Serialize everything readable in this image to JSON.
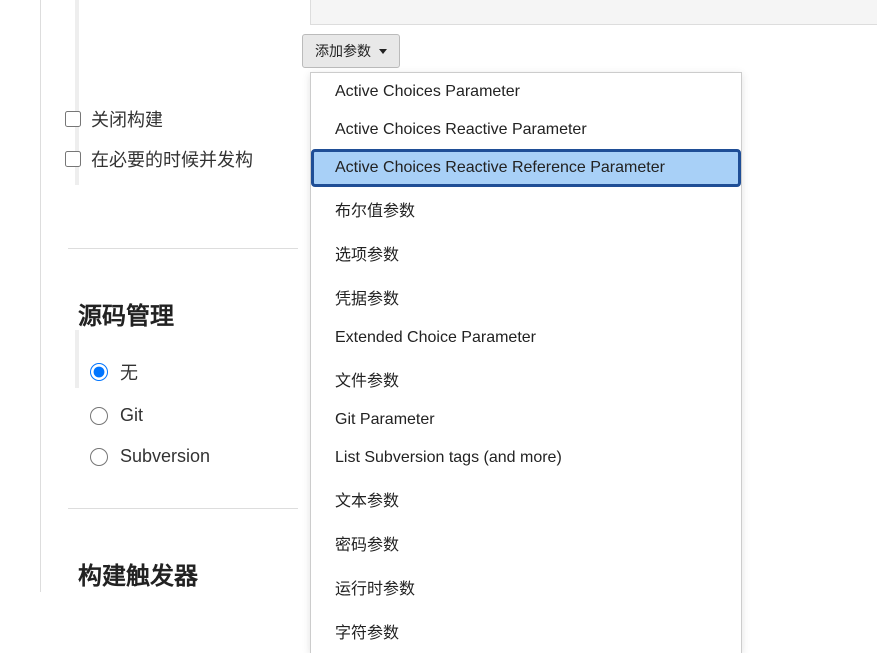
{
  "addParamButton": {
    "label": "添加参数"
  },
  "dropdownItems": [
    {
      "label": "Active Choices Parameter",
      "highlighted": false
    },
    {
      "label": "Active Choices Reactive Parameter",
      "highlighted": false
    },
    {
      "label": "Active Choices Reactive Reference Parameter",
      "highlighted": true
    },
    {
      "label": "布尔值参数",
      "highlighted": false
    },
    {
      "label": "选项参数",
      "highlighted": false
    },
    {
      "label": "凭据参数",
      "highlighted": false
    },
    {
      "label": "Extended Choice Parameter",
      "highlighted": false
    },
    {
      "label": "文件参数",
      "highlighted": false
    },
    {
      "label": "Git Parameter",
      "highlighted": false
    },
    {
      "label": "List Subversion tags (and more)",
      "highlighted": false
    },
    {
      "label": "文本参数",
      "highlighted": false
    },
    {
      "label": "密码参数",
      "highlighted": false
    },
    {
      "label": "运行时参数",
      "highlighted": false
    },
    {
      "label": "字符参数",
      "highlighted": false
    }
  ],
  "checkboxes": [
    {
      "label": "关闭构建",
      "checked": false
    },
    {
      "label": "在必要的时候并发构",
      "checked": false
    }
  ],
  "scmSection": {
    "heading": "源码管理",
    "options": [
      {
        "label": "无",
        "selected": true
      },
      {
        "label": "Git",
        "selected": false
      },
      {
        "label": "Subversion",
        "selected": false
      }
    ]
  },
  "buildTriggerSection": {
    "heading": "构建触发器"
  }
}
